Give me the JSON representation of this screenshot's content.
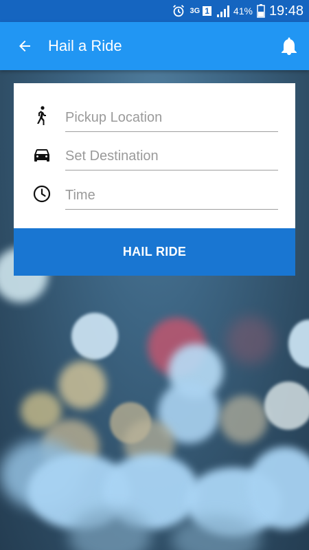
{
  "status_bar": {
    "network": "3G",
    "sim": "1",
    "battery": "41%",
    "time": "19:48",
    "icons": [
      "alarm-icon",
      "signal-icon",
      "battery-icon"
    ]
  },
  "app_bar": {
    "title": "Hail a Ride",
    "back_icon": "arrow-left-icon",
    "bell_icon": "bell-icon",
    "color": "#2196f3"
  },
  "form": {
    "pickup": {
      "placeholder": "Pickup Location",
      "value": "",
      "icon": "walking-person-icon"
    },
    "destination": {
      "placeholder": "Set Destination",
      "value": "",
      "icon": "car-icon"
    },
    "time": {
      "placeholder": "Time",
      "value": "",
      "icon": "clock-icon"
    }
  },
  "action": {
    "label": "HAIL RIDE",
    "color": "#1976d2"
  }
}
